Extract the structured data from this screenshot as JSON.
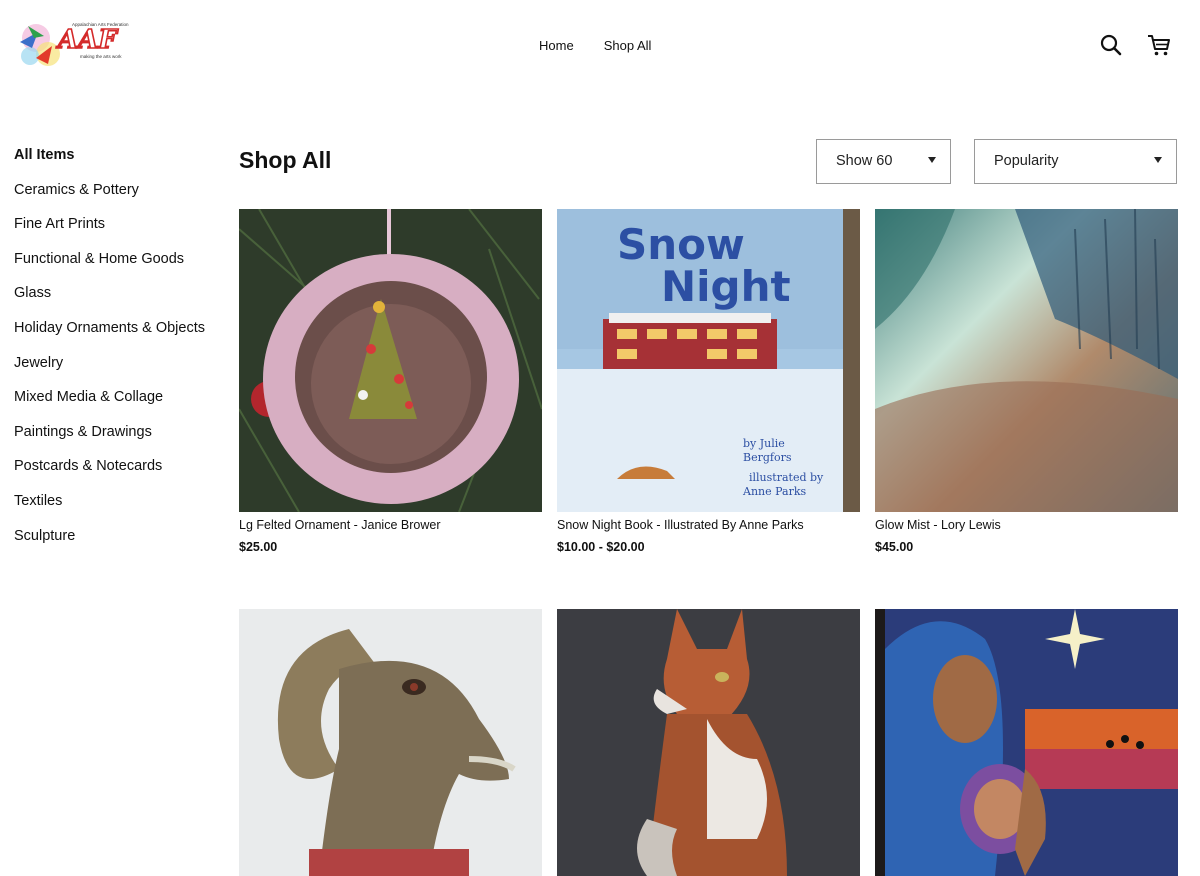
{
  "header": {
    "logo_alt": "Appalachian Arts Federation",
    "logo_text": "AAF",
    "logo_tagline": "making the arts work",
    "logo_top_text": "Appalachian Arts Federation",
    "nav": [
      {
        "label": "Home"
      },
      {
        "label": "Shop All"
      }
    ],
    "icons": {
      "search": "search-icon",
      "cart": "cart-icon"
    }
  },
  "sidebar": {
    "categories": [
      {
        "label": "All Items",
        "active": true
      },
      {
        "label": "Ceramics & Pottery"
      },
      {
        "label": "Fine Art Prints"
      },
      {
        "label": "Functional & Home Goods"
      },
      {
        "label": "Glass"
      },
      {
        "label": "Holiday Ornaments & Objects"
      },
      {
        "label": "Jewelry"
      },
      {
        "label": "Mixed Media & Collage"
      },
      {
        "label": "Paintings & Drawings"
      },
      {
        "label": "Postcards & Notecards"
      },
      {
        "label": "Textiles"
      },
      {
        "label": "Sculpture"
      }
    ]
  },
  "main": {
    "title": "Shop All",
    "show_select": {
      "value": "Show 60"
    },
    "sort_select": {
      "value": "Popularity"
    },
    "products": [
      {
        "name": "Lg Felted Ornament - Janice Brower",
        "price": "$25.00"
      },
      {
        "name": "Snow Night Book - Illustrated By Anne Parks",
        "price": "$10.00 - $20.00",
        "cover_title_1": "Snow",
        "cover_title_2": "Night",
        "cover_author_1": "by Julie",
        "cover_author_2": "Bergfors",
        "cover_illus_1": "illustrated by",
        "cover_illus_2": "Anne Parks"
      },
      {
        "name": "Glow Mist - Lory Lewis",
        "price": "$45.00"
      },
      {
        "name": "",
        "price": ""
      },
      {
        "name": "",
        "price": ""
      },
      {
        "name": "",
        "price": ""
      }
    ]
  },
  "colors": {
    "text": "#111111",
    "border": "#9a9a9a",
    "background": "#ffffff"
  }
}
